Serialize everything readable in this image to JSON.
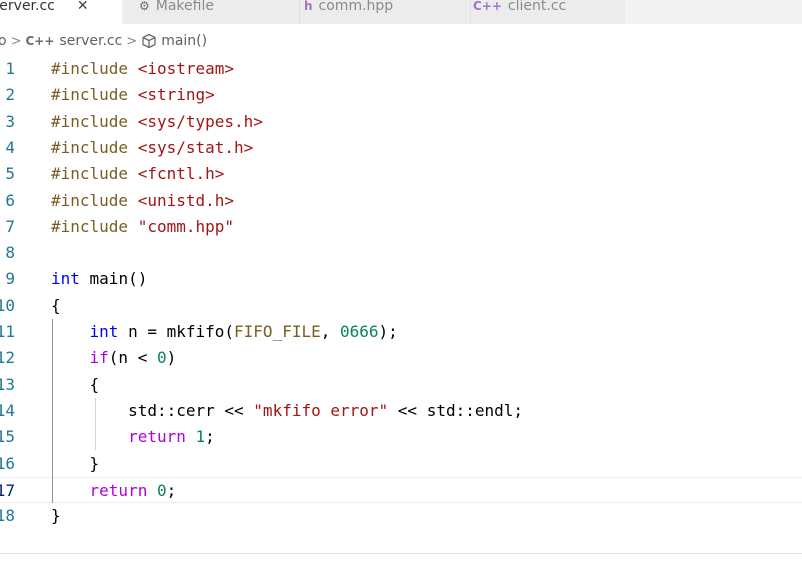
{
  "tabs": [
    {
      "label": "server.cc",
      "icon": "close-icon",
      "close": "✕",
      "active": true
    },
    {
      "label": "Makefile",
      "icon": "gear-icon",
      "glyph": "⚙",
      "active": false
    },
    {
      "label": "comm.hpp",
      "icon": "header-file-icon",
      "glyph": "h",
      "active": false
    },
    {
      "label": "client.cc",
      "icon": "cpp-file-icon",
      "glyph": "C++",
      "active": false
    }
  ],
  "breadcrumb": {
    "folder_fragment": "o",
    "cpp_glyph": "C++",
    "file": "server.cc",
    "symbol": "main()"
  },
  "colors": {
    "keyword": "#0000ff",
    "control_keyword": "#af00db",
    "string": "#a31515",
    "number": "#098658",
    "macro": "#795e26",
    "line_number": "#237893"
  },
  "editor": {
    "lines": [
      {
        "n": "1",
        "tokens": [
          [
            "mac",
            "#include "
          ],
          [
            "str",
            "<iostream>"
          ]
        ]
      },
      {
        "n": "2",
        "tokens": [
          [
            "mac",
            "#include "
          ],
          [
            "str",
            "<string>"
          ]
        ]
      },
      {
        "n": "3",
        "tokens": [
          [
            "mac",
            "#include "
          ],
          [
            "str",
            "<sys/types.h>"
          ]
        ]
      },
      {
        "n": "4",
        "tokens": [
          [
            "mac",
            "#include "
          ],
          [
            "str",
            "<sys/stat.h>"
          ]
        ]
      },
      {
        "n": "5",
        "tokens": [
          [
            "mac",
            "#include "
          ],
          [
            "str",
            "<fcntl.h>"
          ]
        ]
      },
      {
        "n": "6",
        "tokens": [
          [
            "mac",
            "#include "
          ],
          [
            "str",
            "<unistd.h>"
          ]
        ]
      },
      {
        "n": "7",
        "tokens": [
          [
            "mac",
            "#include "
          ],
          [
            "str",
            "\"comm.hpp\""
          ]
        ]
      },
      {
        "n": "8",
        "tokens": []
      },
      {
        "n": "9",
        "tokens": [
          [
            "kw",
            "int"
          ],
          [
            "plain",
            " main()"
          ]
        ]
      },
      {
        "n": "10",
        "tokens": [
          [
            "plain",
            "{"
          ]
        ]
      },
      {
        "n": "11",
        "tokens": [
          [
            "plain",
            "    "
          ],
          [
            "kw",
            "int"
          ],
          [
            "plain",
            " n = mkfifo("
          ],
          [
            "mac",
            "FIFO_FILE"
          ],
          [
            "plain",
            ", "
          ],
          [
            "num",
            "0666"
          ],
          [
            "plain",
            ");"
          ]
        ]
      },
      {
        "n": "12",
        "tokens": [
          [
            "plain",
            "    "
          ],
          [
            "kw-ctrl",
            "if"
          ],
          [
            "plain",
            "(n < "
          ],
          [
            "num",
            "0"
          ],
          [
            "plain",
            ")"
          ]
        ]
      },
      {
        "n": "13",
        "tokens": [
          [
            "plain",
            "    {"
          ]
        ]
      },
      {
        "n": "14",
        "tokens": [
          [
            "plain",
            "        std::cerr << "
          ],
          [
            "str",
            "\"mkfifo error\""
          ],
          [
            "plain",
            " << std::endl;"
          ]
        ]
      },
      {
        "n": "15",
        "tokens": [
          [
            "plain",
            "        "
          ],
          [
            "kw-ctrl",
            "return"
          ],
          [
            "plain",
            " "
          ],
          [
            "num",
            "1"
          ],
          [
            "plain",
            ";"
          ]
        ]
      },
      {
        "n": "16",
        "tokens": [
          [
            "plain",
            "    }"
          ]
        ]
      },
      {
        "n": "17",
        "tokens": [
          [
            "plain",
            "    "
          ],
          [
            "kw-ctrl",
            "return"
          ],
          [
            "plain",
            " "
          ],
          [
            "num",
            "0"
          ],
          [
            "plain",
            ";"
          ]
        ],
        "current": true
      },
      {
        "n": "18",
        "tokens": [
          [
            "plain",
            "}"
          ]
        ]
      }
    ]
  }
}
